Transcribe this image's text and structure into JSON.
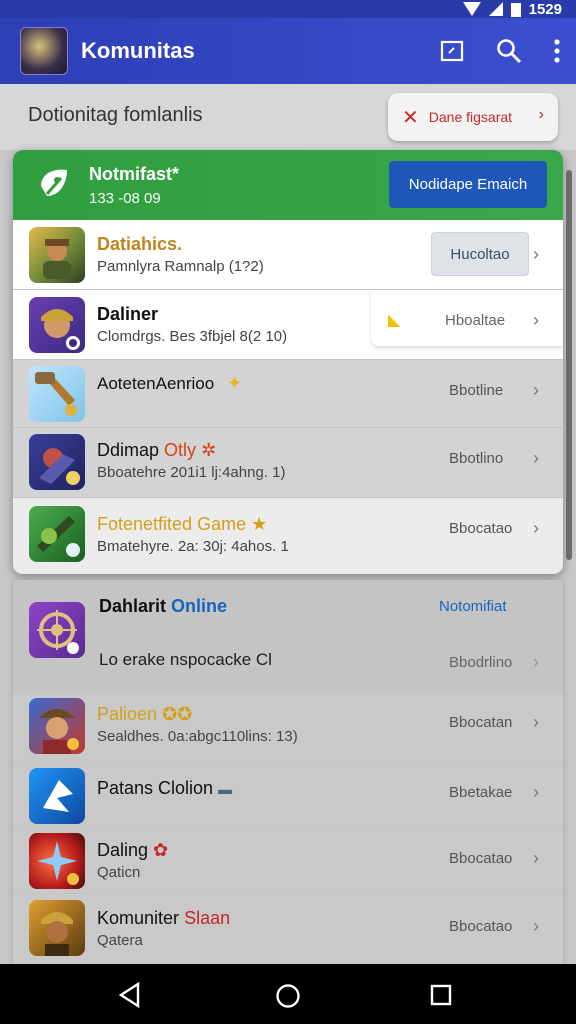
{
  "status_bar": {
    "time": "1529"
  },
  "app_bar": {
    "title": "Komunitas"
  },
  "section": {
    "title": "Dotionitag fomlanlis"
  },
  "filter_chip": {
    "label": "Dane figsarat"
  },
  "notification": {
    "title": "Notmifast*",
    "subtitle": "133 -08 09",
    "button_label": "Nodidape Emaich"
  },
  "card_rows": [
    {
      "title": "Datiahics.",
      "subtitle": "Pamnlyra Ramnalp (1?2)",
      "action": "Hucoltao"
    },
    {
      "title": "Daliner",
      "subtitle": "Clomdrgs. Bes 3fbjel 8(2 10)",
      "action": "Hboaltae"
    },
    {
      "title": "AotetenAenrioo",
      "subtitle": "",
      "action": "Bbotline"
    },
    {
      "title": "Ddimap",
      "title_accent": "Otly",
      "subtitle": "Bboatehre 201i1 lj:4ahng. 1)",
      "action": "Bbotlino"
    },
    {
      "title": "Fotenetfited Game",
      "subtitle": "Bmatehyre. 2a: 30j: 4ahos. 1",
      "action": "Bbocatao"
    }
  ],
  "featured": {
    "title": "Dahlarit",
    "title_accent": "Online",
    "action": "Notomifiat",
    "subtitle": "Lo erake nspocacke Cl",
    "secondary_action": "Bbodrlino"
  },
  "lower_rows": [
    {
      "title": "Palioen",
      "subtitle": "Sealdhes. 0a:abgc110lins: 13)",
      "action": "Bbocatan"
    },
    {
      "title": "Patans Clolion",
      "subtitle": "",
      "action": "Bbetakae"
    },
    {
      "title": "Daling",
      "subtitle": "Qaticn",
      "action": "Bbocatao"
    },
    {
      "title": "Komuniter",
      "title_accent": "Slaan",
      "subtitle": "Qatera",
      "action": "Bbocatao"
    }
  ]
}
